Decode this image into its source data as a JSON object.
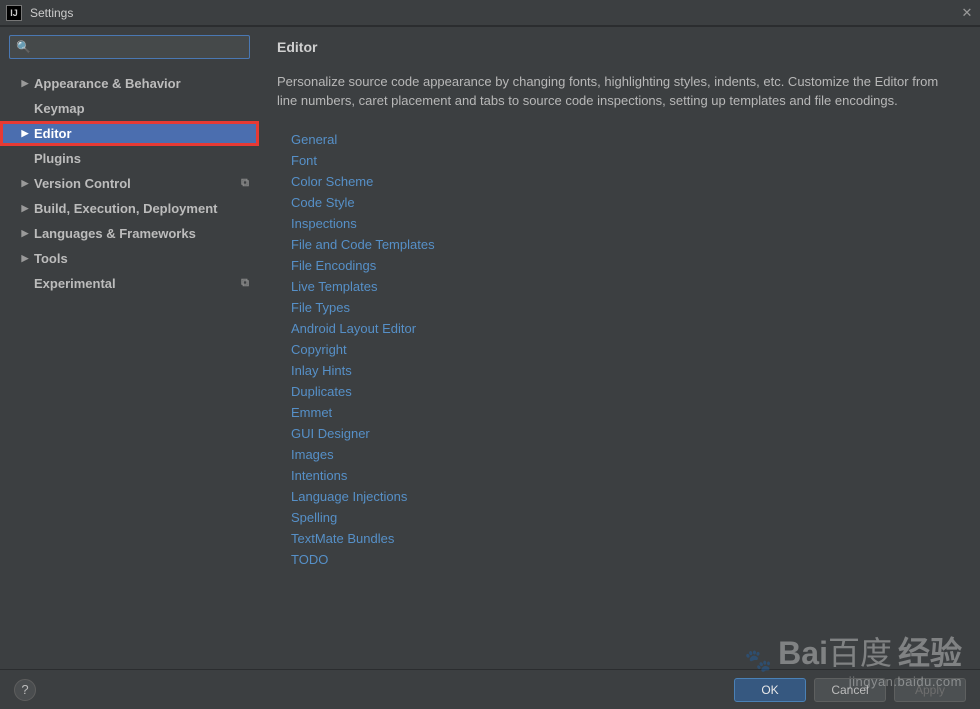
{
  "window": {
    "title": "Settings",
    "close_glyph": "✕"
  },
  "search": {
    "placeholder": ""
  },
  "sidebar": {
    "items": [
      {
        "label": "Appearance & Behavior",
        "expandable": true,
        "selected": false,
        "tail": false
      },
      {
        "label": "Keymap",
        "expandable": false,
        "selected": false,
        "tail": false
      },
      {
        "label": "Editor",
        "expandable": true,
        "selected": true,
        "tail": false,
        "highlight": true
      },
      {
        "label": "Plugins",
        "expandable": false,
        "selected": false,
        "tail": false
      },
      {
        "label": "Version Control",
        "expandable": true,
        "selected": false,
        "tail": true
      },
      {
        "label": "Build, Execution, Deployment",
        "expandable": true,
        "selected": false,
        "tail": false
      },
      {
        "label": "Languages & Frameworks",
        "expandable": true,
        "selected": false,
        "tail": false
      },
      {
        "label": "Tools",
        "expandable": true,
        "selected": false,
        "tail": false
      },
      {
        "label": "Experimental",
        "expandable": false,
        "selected": false,
        "tail": true
      }
    ]
  },
  "detail": {
    "heading": "Editor",
    "description": "Personalize source code appearance by changing fonts, highlighting styles, indents, etc. Customize the Editor from line numbers, caret placement and tabs to source code inspections, setting up templates and file encodings.",
    "links": [
      "General",
      "Font",
      "Color Scheme",
      "Code Style",
      "Inspections",
      "File and Code Templates",
      "File Encodings",
      "Live Templates",
      "File Types",
      "Android Layout Editor",
      "Copyright",
      "Inlay Hints",
      "Duplicates",
      "Emmet",
      "GUI Designer",
      "Images",
      "Intentions",
      "Language Injections",
      "Spelling",
      "TextMate Bundles",
      "TODO"
    ]
  },
  "footer": {
    "help": "?",
    "ok": "OK",
    "cancel": "Cancel",
    "apply": "Apply"
  },
  "watermark": {
    "brand": "Bai",
    "brand_suffix": "百度",
    "sub1": "经验",
    "url": "jingyan.baidu.com"
  }
}
